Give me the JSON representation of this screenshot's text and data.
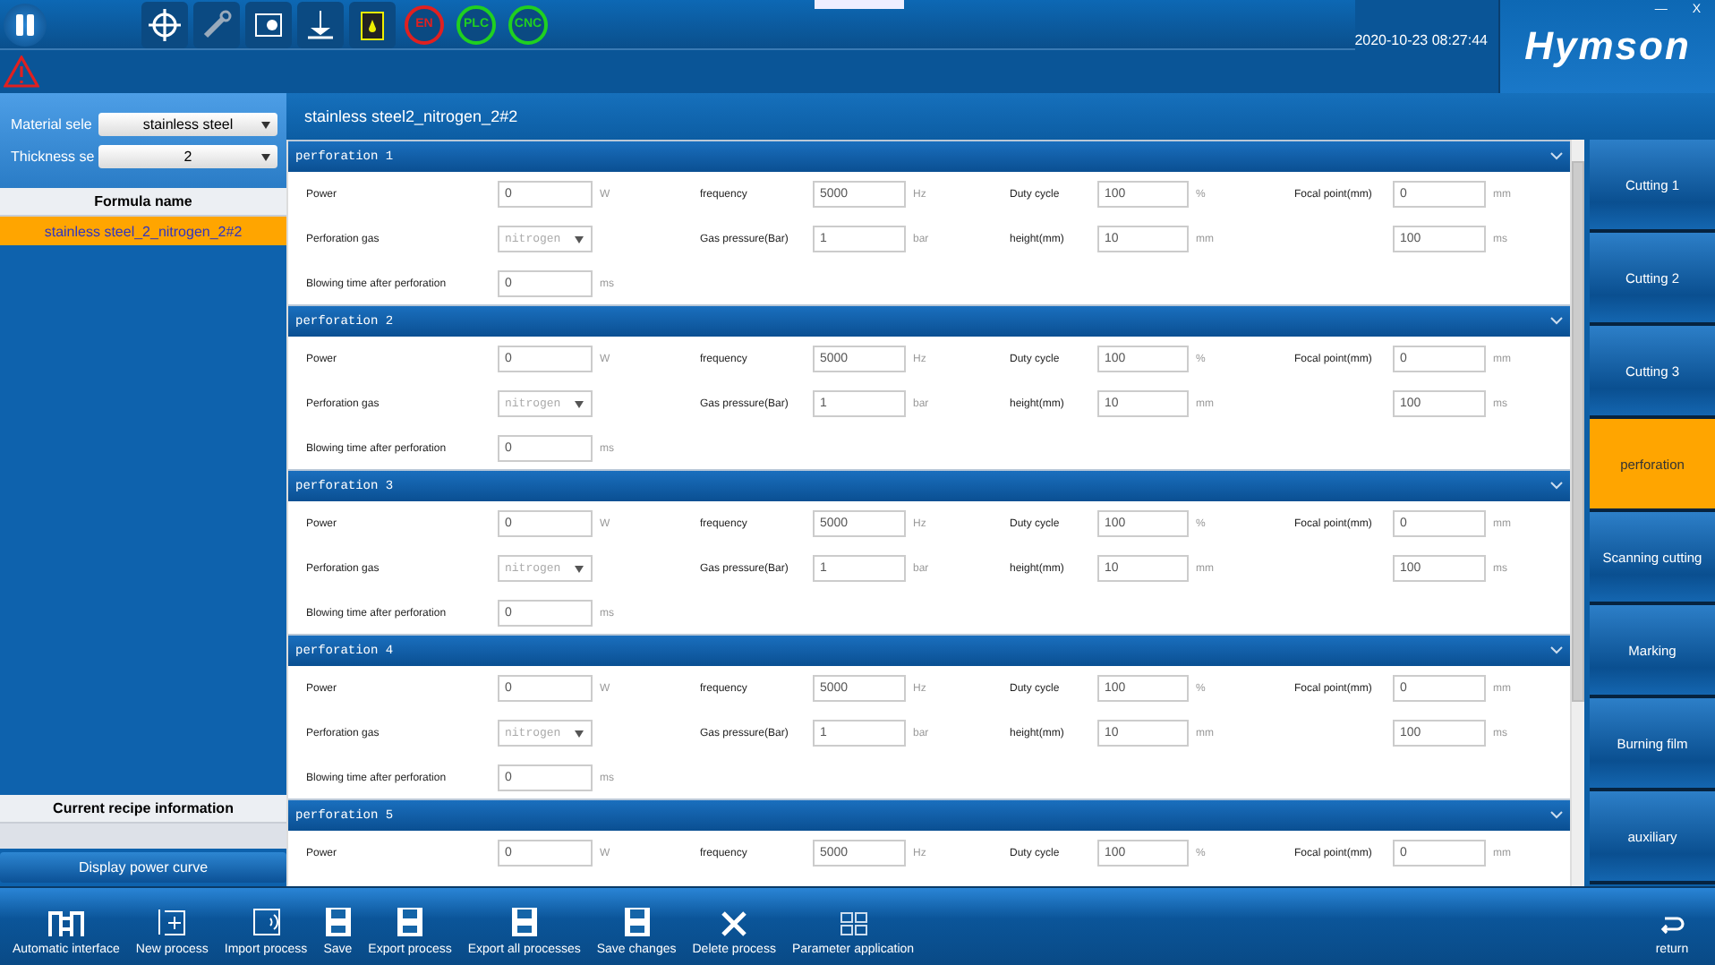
{
  "toolbar": {
    "status_badges": [
      {
        "text": "EN",
        "color": "#e02020"
      },
      {
        "text": "PLC",
        "color": "#20d020"
      },
      {
        "text": "CNC",
        "color": "#20d020"
      }
    ],
    "datetime": "2020-10-23 08:27:44",
    "logo": "Hymson",
    "window_controls": [
      "—",
      "X"
    ]
  },
  "left_panel": {
    "material_label": "Material sele",
    "material_value": "stainless steel",
    "thickness_label": "Thickness se",
    "thickness_value": "2",
    "formula_header": "Formula name",
    "formulas": [
      {
        "name": "stainless steel_2_nitrogen_2#2",
        "selected": true
      }
    ],
    "recipe_header": "Current recipe information",
    "power_curve_button": "Display power curve"
  },
  "title": "stainless steel2_nitrogen_2#2",
  "sections": [
    {
      "title": "perforation 1",
      "fields": [
        {
          "kind": "input",
          "label": "Power",
          "value": "0",
          "unit": "W"
        },
        {
          "kind": "input",
          "label": "frequency",
          "value": "5000",
          "unit": "Hz"
        },
        {
          "kind": "input",
          "label": "Duty cycle",
          "value": "100",
          "unit": "%"
        },
        {
          "kind": "input",
          "label": "Focal point(mm)",
          "value": "0",
          "unit": "mm"
        },
        {
          "kind": "select",
          "label": "Perforation gas",
          "value": "nitrogen"
        },
        {
          "kind": "input",
          "label": "Gas pressure(Bar)",
          "value": "1",
          "unit": "bar"
        },
        {
          "kind": "input",
          "label": "height(mm)",
          "value": "10",
          "unit": "mm"
        },
        {
          "kind": "input",
          "value": "100",
          "unit": "ms"
        },
        {
          "kind": "input",
          "label": "Blowing time after perforation",
          "value": "0",
          "unit": "ms"
        }
      ]
    },
    {
      "title": "perforation 2",
      "fields": [
        {
          "kind": "input",
          "label": "Power",
          "value": "0",
          "unit": "W"
        },
        {
          "kind": "input",
          "label": "frequency",
          "value": "5000",
          "unit": "Hz"
        },
        {
          "kind": "input",
          "label": "Duty cycle",
          "value": "100",
          "unit": "%"
        },
        {
          "kind": "input",
          "label": "Focal point(mm)",
          "value": "0",
          "unit": "mm"
        },
        {
          "kind": "select",
          "label": "Perforation gas",
          "value": "nitrogen"
        },
        {
          "kind": "input",
          "label": "Gas pressure(Bar)",
          "value": "1",
          "unit": "bar"
        },
        {
          "kind": "input",
          "label": "height(mm)",
          "value": "10",
          "unit": "mm"
        },
        {
          "kind": "input",
          "value": "100",
          "unit": "ms"
        },
        {
          "kind": "input",
          "label": "Blowing time after perforation",
          "value": "0",
          "unit": "ms"
        }
      ]
    },
    {
      "title": "perforation 3",
      "fields": [
        {
          "kind": "input",
          "label": "Power",
          "value": "0",
          "unit": "W"
        },
        {
          "kind": "input",
          "label": "frequency",
          "value": "5000",
          "unit": "Hz"
        },
        {
          "kind": "input",
          "label": "Duty cycle",
          "value": "100",
          "unit": "%"
        },
        {
          "kind": "input",
          "label": "Focal point(mm)",
          "value": "0",
          "unit": "mm"
        },
        {
          "kind": "select",
          "label": "Perforation gas",
          "value": "nitrogen"
        },
        {
          "kind": "input",
          "label": "Gas pressure(Bar)",
          "value": "1",
          "unit": "bar"
        },
        {
          "kind": "input",
          "label": "height(mm)",
          "value": "10",
          "unit": "mm"
        },
        {
          "kind": "input",
          "value": "100",
          "unit": "ms"
        },
        {
          "kind": "input",
          "label": "Blowing time after perforation",
          "value": "0",
          "unit": "ms"
        }
      ]
    },
    {
      "title": "perforation 4",
      "fields": [
        {
          "kind": "input",
          "label": "Power",
          "value": "0",
          "unit": "W"
        },
        {
          "kind": "input",
          "label": "frequency",
          "value": "5000",
          "unit": "Hz"
        },
        {
          "kind": "input",
          "label": "Duty cycle",
          "value": "100",
          "unit": "%"
        },
        {
          "kind": "input",
          "label": "Focal point(mm)",
          "value": "0",
          "unit": "mm"
        },
        {
          "kind": "select",
          "label": "Perforation gas",
          "value": "nitrogen"
        },
        {
          "kind": "input",
          "label": "Gas pressure(Bar)",
          "value": "1",
          "unit": "bar"
        },
        {
          "kind": "input",
          "label": "height(mm)",
          "value": "10",
          "unit": "mm"
        },
        {
          "kind": "input",
          "value": "100",
          "unit": "ms"
        },
        {
          "kind": "input",
          "label": "Blowing time after perforation",
          "value": "0",
          "unit": "ms"
        }
      ]
    },
    {
      "title": "perforation 5",
      "fields": [
        {
          "kind": "input",
          "label": "Power",
          "value": "0",
          "unit": "W"
        },
        {
          "kind": "input",
          "label": "frequency",
          "value": "5000",
          "unit": "Hz"
        },
        {
          "kind": "input",
          "label": "Duty cycle",
          "value": "100",
          "unit": "%"
        },
        {
          "kind": "input",
          "label": "Focal point(mm)",
          "value": "0",
          "unit": "mm"
        }
      ]
    }
  ],
  "tabs": [
    {
      "label": "Cutting 1",
      "selected": false
    },
    {
      "label": "Cutting 2",
      "selected": false
    },
    {
      "label": "Cutting 3",
      "selected": false
    },
    {
      "label": "perforation",
      "selected": true
    },
    {
      "label": "Scanning cutting",
      "selected": false
    },
    {
      "label": "Marking",
      "selected": false
    },
    {
      "label": "Burning film",
      "selected": false
    },
    {
      "label": "auxiliary",
      "selected": false
    }
  ],
  "bottom_toolbar": [
    {
      "kind": "auto",
      "label": "Automatic interface"
    },
    {
      "kind": "new",
      "label": "New process"
    },
    {
      "kind": "import",
      "label": "Import process"
    },
    {
      "kind": "save",
      "label": "Save"
    },
    {
      "kind": "save",
      "label": "Export process"
    },
    {
      "kind": "save",
      "label": "Export all processes"
    },
    {
      "kind": "save",
      "label": "Save changes"
    },
    {
      "kind": "delete",
      "label": "Delete process"
    },
    {
      "kind": "params",
      "label": "Parameter application"
    }
  ],
  "return_button": "return"
}
